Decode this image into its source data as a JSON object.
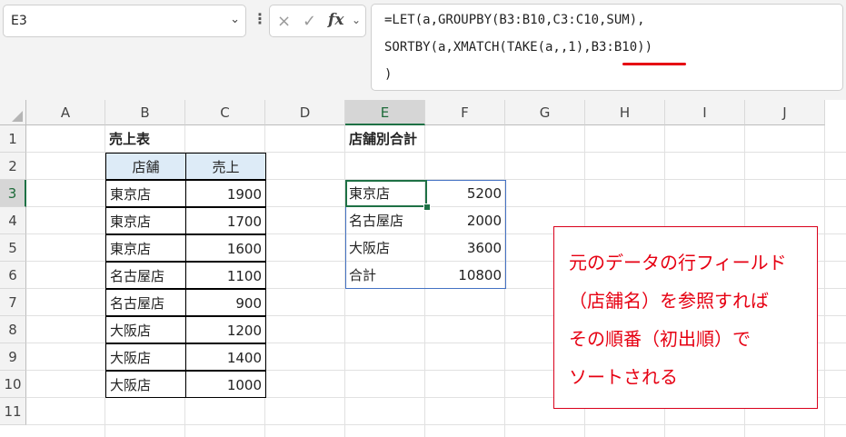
{
  "namebox": {
    "value": "E3"
  },
  "formula_bar": {
    "lines": [
      "=LET(a,GROUPBY(B3:B10,C3:C10,SUM),",
      "SORTBY(a,XMATCH(TAKE(a,,1),B3:B10))",
      ")"
    ],
    "highlight_text": "B3:B10",
    "underline_color": "#e60012"
  },
  "icons": {
    "cancel": "×",
    "enter": "✓",
    "fx": "fx",
    "dropdown": "⌄",
    "more": "⋮"
  },
  "columns": [
    "A",
    "B",
    "C",
    "D",
    "E",
    "F",
    "G",
    "H",
    "I",
    "J"
  ],
  "rows": [
    "1",
    "2",
    "3",
    "4",
    "5",
    "6",
    "7",
    "8",
    "9",
    "10",
    "11"
  ],
  "selected": {
    "column": "E",
    "row": "3"
  },
  "sales_table": {
    "title": "売上表",
    "headers": [
      "店舗",
      "売上"
    ],
    "rows": [
      [
        "東京店",
        "1900"
      ],
      [
        "東京店",
        "1700"
      ],
      [
        "東京店",
        "1600"
      ],
      [
        "名古屋店",
        "1100"
      ],
      [
        "名古屋店",
        "900"
      ],
      [
        "大阪店",
        "1200"
      ],
      [
        "大阪店",
        "1400"
      ],
      [
        "大阪店",
        "1000"
      ]
    ]
  },
  "summary_table": {
    "title": "店舗別合計",
    "rows": [
      [
        "東京店",
        "5200"
      ],
      [
        "名古屋店",
        "2000"
      ],
      [
        "大阪店",
        "3600"
      ],
      [
        "合計",
        "10800"
      ]
    ]
  },
  "note": {
    "lines": [
      "元のデータの行フィールド",
      "（店舗名）を参照すれば",
      "その順番（初出順）で",
      "ソートされる"
    ],
    "color": "#e60012"
  },
  "colors": {
    "accent": "#1e7145",
    "table_border": "#4472c4",
    "header_fill": "#ddebf7"
  }
}
